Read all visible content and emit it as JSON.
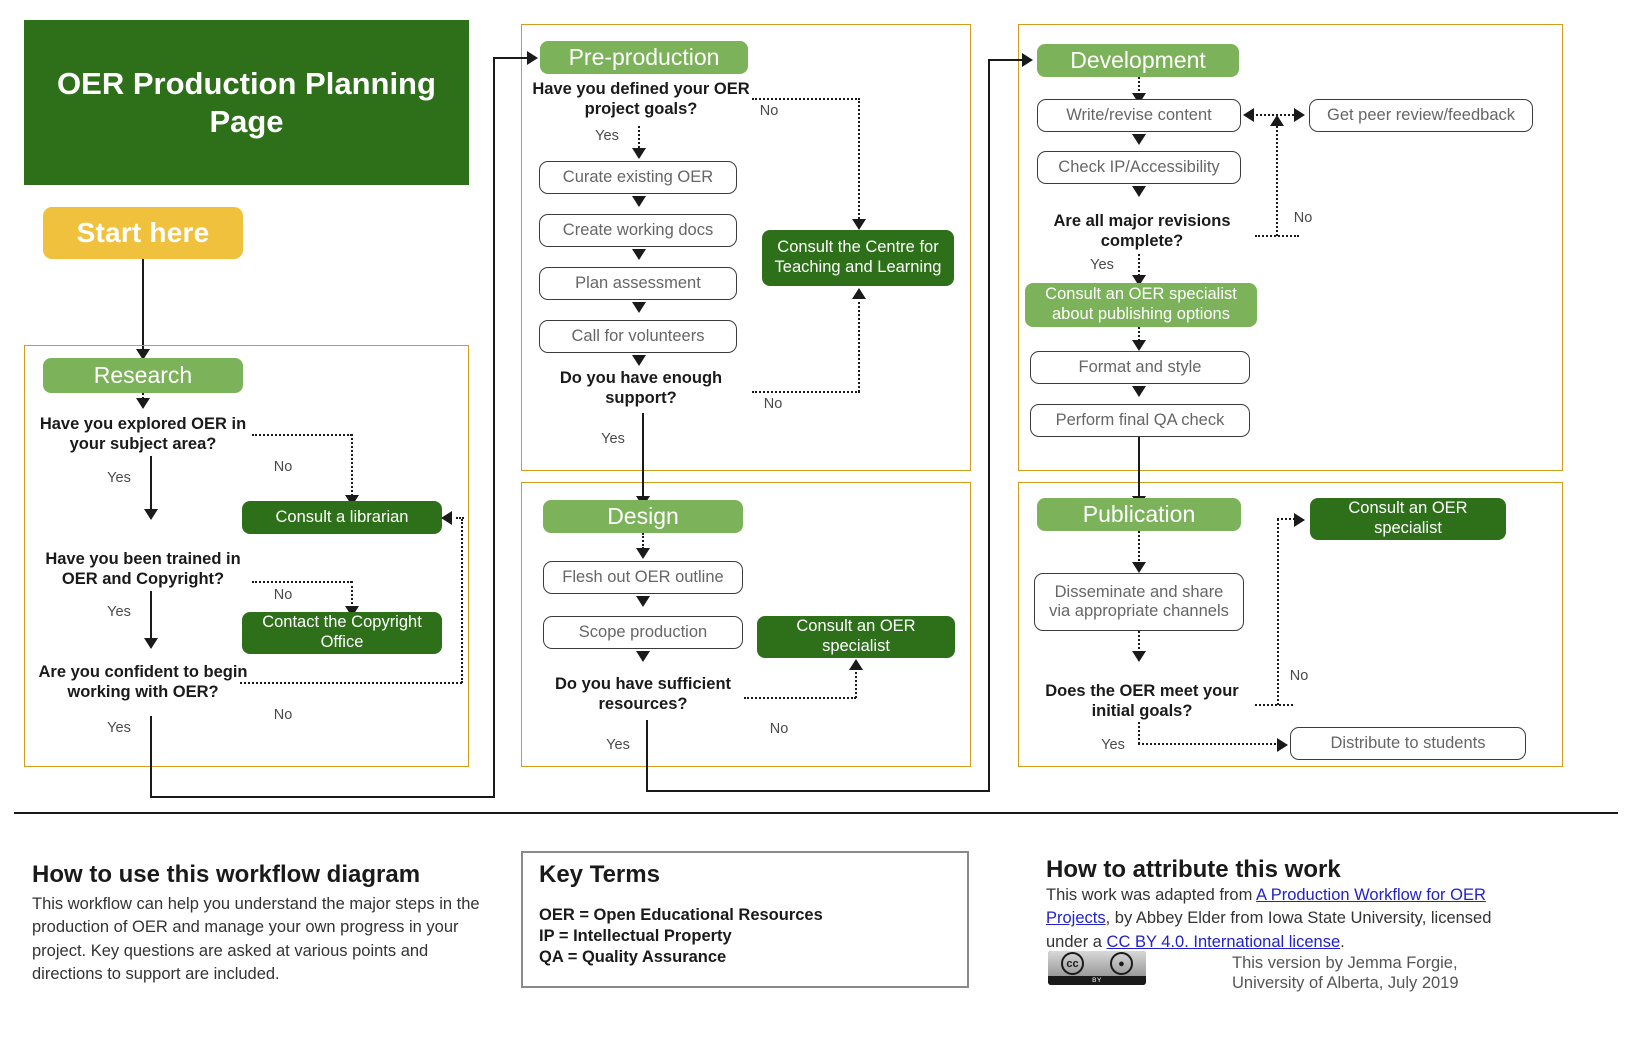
{
  "title": {
    "text": "OER Production Planning Page"
  },
  "start": {
    "label": "Start here"
  },
  "labels": {
    "yes": "Yes",
    "no": "No"
  },
  "stages": {
    "research": {
      "chip": "Research",
      "q1": "Have you explored OER in your subject area?",
      "q2": "Have you been trained in OER and Copyright?",
      "q3": "Are you confident to begin working with OER?",
      "support1": "Consult a librarian",
      "support2": "Contact the Copyright Office",
      "yes1": "Yes",
      "yes2": "Yes",
      "yes3": "Yes",
      "no1": "No",
      "no2": "No",
      "no3": "No"
    },
    "preproduction": {
      "chip": "Pre-production",
      "q1": "Have you defined your OER project goals?",
      "steps": [
        "Curate existing OER",
        "Create working docs",
        "Plan assessment",
        "Call for volunteers"
      ],
      "q2": "Do you have enough support?",
      "support": "Consult the Centre for Teaching and Learning",
      "yes1": "Yes",
      "yes2": "Yes",
      "no1": "No",
      "no2": "No"
    },
    "design": {
      "chip": "Design",
      "steps": [
        "Flesh out OER outline",
        "Scope production"
      ],
      "q1": "Do you have sufficient resources?",
      "support": "Consult an OER specialist",
      "yes1": "Yes",
      "no1": "No"
    },
    "development": {
      "chip": "Development",
      "steps": [
        "Write/revise content",
        "Check IP/Accessibility"
      ],
      "peer": "Get peer review/feedback",
      "q1": "Are all major revisions complete?",
      "support": "Consult an OER specialist about publishing options",
      "steps2": [
        "Format and style",
        "Perform final QA check"
      ],
      "yes1": "Yes",
      "no1": "No"
    },
    "publication": {
      "chip": "Publication",
      "support": "Consult an OER specialist",
      "step1": "Disseminate and share via appropriate channels",
      "q1": "Does the OER meet your initial goals?",
      "distribute": "Distribute to students",
      "yes1": "Yes",
      "no1": "No"
    }
  },
  "footer": {
    "howto_heading": "How to use this workflow diagram",
    "howto_body": "This workflow can help you understand the major steps in the production of OER and manage your own progress in your project. Key questions are asked at various points and directions to support are included.",
    "keyterms_heading": "Key Terms",
    "keyterms": [
      "OER = Open Educational Resources",
      "IP = Intellectual Property",
      "QA = Quality Assurance"
    ],
    "attribute_heading": "How to attribute this work",
    "attr_pre": "This work was adapted from ",
    "attr_link1": "A Production Workflow for OER Projects",
    "attr_mid": ", by Abbey Elder from Iowa State University, licensed under a ",
    "attr_link2": "CC BY 4.0. International license",
    "attr_end": ".",
    "version_line1": "This version by Jemma Forgie,",
    "version_line2": "University of Alberta, July 2019",
    "cc_mark": "cc",
    "cc_by_mark": "BY"
  },
  "colors": {
    "dark_green": "#2d7019",
    "light_green": "#7cb25a",
    "gold": "#f0c13c",
    "panel_border": "#d19d1a",
    "link": "#2222cc"
  }
}
